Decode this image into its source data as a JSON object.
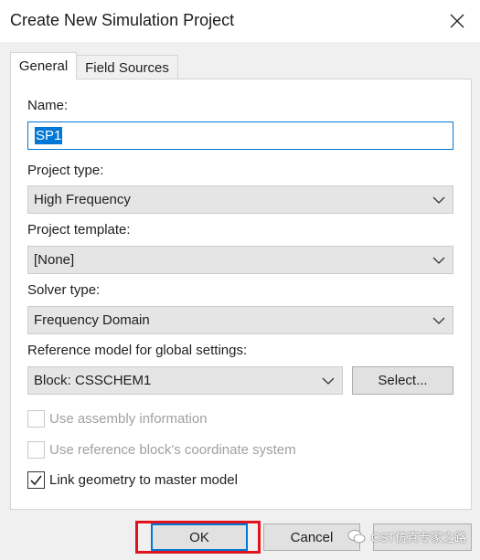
{
  "dialog": {
    "title": "Create New Simulation Project"
  },
  "tabs": [
    {
      "label": "General",
      "selected": true
    },
    {
      "label": "Field Sources",
      "selected": false
    }
  ],
  "form": {
    "name_label": "Name:",
    "name_value": "SP1",
    "project_type_label": "Project type:",
    "project_type_value": "High Frequency",
    "project_template_label": "Project template:",
    "project_template_value": "[None]",
    "solver_type_label": "Solver type:",
    "solver_type_value": "Frequency Domain",
    "reference_model_label": "Reference model for global settings:",
    "reference_model_value": "Block: CSSCHEM1",
    "select_button": "Select...",
    "use_assembly_label": "Use assembly information",
    "use_assembly_checked": false,
    "use_reference_block_label": "Use reference block's coordinate system",
    "use_reference_block_checked": false,
    "link_geometry_label": "Link geometry to master model",
    "link_geometry_checked": true
  },
  "buttons": {
    "ok": "OK",
    "cancel": "Cancel"
  },
  "watermark": {
    "text": "CST仿真专家之路"
  },
  "colors": {
    "accent": "#0078d7",
    "highlight": "#e0131e"
  }
}
